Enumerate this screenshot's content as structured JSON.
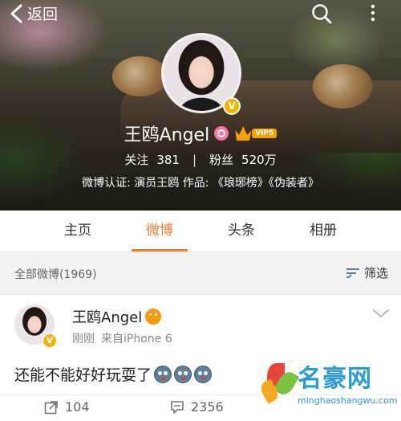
{
  "header": {
    "back_label": "返回",
    "icons": [
      "chevron-left-icon",
      "search-icon",
      "more-icon"
    ]
  },
  "profile": {
    "name": "王鸥Angel",
    "vip_level": "VIP5",
    "following_label": "关注",
    "following_count": "381",
    "separator": "|",
    "followers_label": "粉丝",
    "followers_count": "520万",
    "verification": "微博认证: 演员王鸥 作品: 《琅琊榜》《伪装者》"
  },
  "tabs": [
    {
      "label": "主页",
      "active": false
    },
    {
      "label": "微博",
      "active": true
    },
    {
      "label": "头条",
      "active": false
    },
    {
      "label": "相册",
      "active": false
    }
  ],
  "filter": {
    "count_label": "全部微博(1969)",
    "filter_label": "筛选"
  },
  "post": {
    "author": "王鸥Angel",
    "time": "刚刚",
    "source": "来自iPhone 6",
    "text": "还能不能好好玩耍了",
    "emoji_count": 3,
    "reposts": "104",
    "comments": "2356"
  },
  "watermark": {
    "title": "名豪网",
    "subtitle": "minghaoshangwu.com"
  },
  "colors": {
    "accent": "#f07c2f",
    "verified_badge": "#f5b301",
    "watermark": "#2b9bd3"
  }
}
